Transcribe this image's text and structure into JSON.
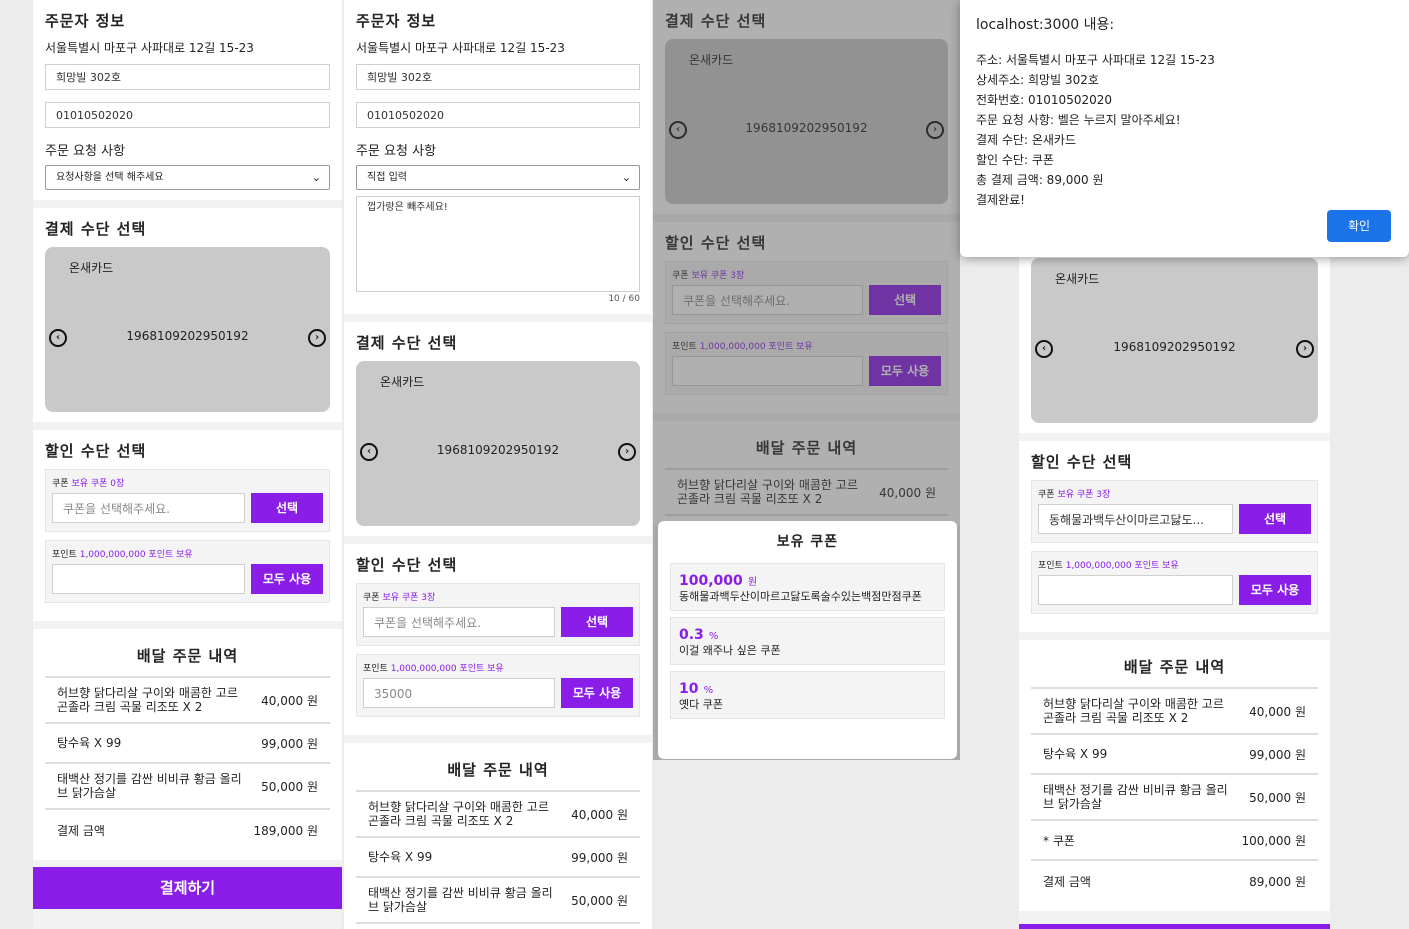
{
  "orderer": {
    "title": "주문자 정보",
    "address": "서울특별시 마포구 사파대로 12길 15-23",
    "detail": "희망빌 302호",
    "phone": "01010502020",
    "request_label": "주문 요청 사항",
    "request_placeholder": "요청사항을 선택 해주세요",
    "request_direct": "직접 입력",
    "request_text": "껍가랑은 빼주세요!",
    "char_count": "10 / 60"
  },
  "payment": {
    "title": "결제 수단 선택",
    "card_name": "온새카드",
    "card_number": "1968109202950192",
    "prev_icon": "chevron-left-circle",
    "next_icon": "chevron-right-circle"
  },
  "discount": {
    "title": "할인 수단 선택",
    "coupon_prefix": "쿠폰",
    "coupon_count_0": "보유 쿠폰 0장",
    "coupon_count_3": "보유 쿠폰 3장",
    "coupon_placeholder": "쿠폰을 선택해주세요.",
    "coupon_selected": "동해물과백두산이마르고닳도...",
    "select_btn": "선택",
    "point_prefix": "포인트",
    "point_owned": "1,000,000,000 포인트 보유",
    "point_value": "35000",
    "use_all_btn": "모두 사용"
  },
  "order": {
    "title": "배달 주문 내역",
    "items": [
      {
        "name": "허브향 닭다리살 구이와 매콤한 고르곤졸라 크림 곡물 리조또 X 2",
        "price": "40,000 원"
      },
      {
        "name": "탕수육 X 99",
        "price": "99,000 원"
      },
      {
        "name": "태백산 정기를 감싼 비비큐 황금 올리브 닭가슴살",
        "price": "50,000 원"
      }
    ],
    "coupon_line": {
      "name": "* 쿠폰",
      "price": "100,000 원"
    },
    "total_label": "결제 금액",
    "total_1": "189,000 원",
    "total_4": "89,000 원",
    "pay_btn": "결제하기"
  },
  "coupon_modal": {
    "title": "보유 쿠폰",
    "coupons": [
      {
        "amount": "100,000",
        "unit": "원",
        "name": "동해물과백두산이마르고닳도록술수있는백점만점쿠폰"
      },
      {
        "amount": "0.3",
        "unit": "%",
        "name": "이걸 왜주나 싶은 쿠폰"
      },
      {
        "amount": "10",
        "unit": "%",
        "name": "옛다 쿠폰"
      }
    ]
  },
  "alert": {
    "title": "localhost:3000 내용:",
    "lines": [
      "주소: 서울특별시 마포구 사파대로 12길 15-23",
      "상세주소: 희망빌 302호",
      "전화번호: 01010502020",
      "주문 요청 사항: 벨은 누르지 말아주세요!",
      "결제 수단: 온새카드",
      "할인 수단: 쿠폰",
      "총 결제 금액: 89,000 원",
      "결제완료!"
    ],
    "ok": "확인"
  },
  "colors": {
    "accent": "#8a1de8",
    "card_bg": "#c9c9c9",
    "alert_button": "#1a73e8"
  }
}
